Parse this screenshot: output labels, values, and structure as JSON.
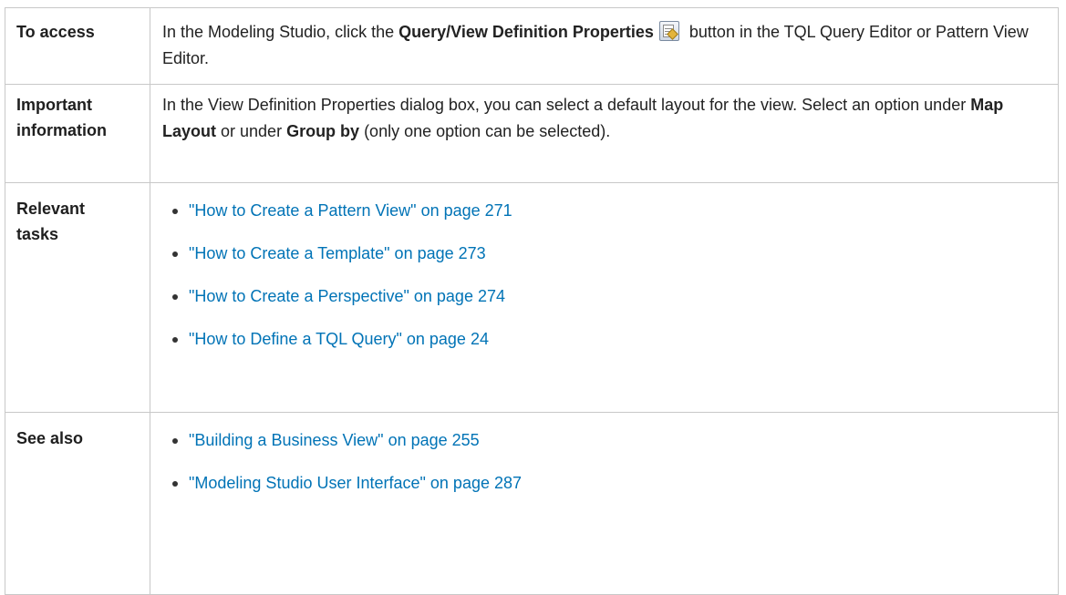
{
  "rows": {
    "access": {
      "label": "To access",
      "text_1": "In the Modeling Studio, click the ",
      "bold_1": "Query/View Definition Properties",
      "icon": "query-view-definition-properties-icon",
      "text_2": " button in the TQL Query Editor or Pattern View Editor."
    },
    "important": {
      "label_line1": "Important",
      "label_line2": "information",
      "text_1": "In the View Definition Properties dialog box, you can select a default layout for the view. Select an option under ",
      "bold_1": "Map Layout",
      "text_2": " or under ",
      "bold_2": "Group by",
      "text_3": " (only one option can be selected)."
    },
    "tasks": {
      "label_line1": "Relevant",
      "label_line2": "tasks",
      "links": [
        "\"How to Create a Pattern View\" on page 271",
        "\"How to Create a Template\" on page 273",
        "\"How to Create a Perspective\" on page 274",
        "\"How to Define a TQL Query\" on page 24"
      ]
    },
    "see_also": {
      "label": "See also",
      "links": [
        "\"Building a Business View\" on page 255",
        "\"Modeling Studio User Interface\" on page 287"
      ]
    }
  },
  "colors": {
    "link": "#0073b6",
    "border": "#c8c8c8",
    "text": "#222222"
  }
}
